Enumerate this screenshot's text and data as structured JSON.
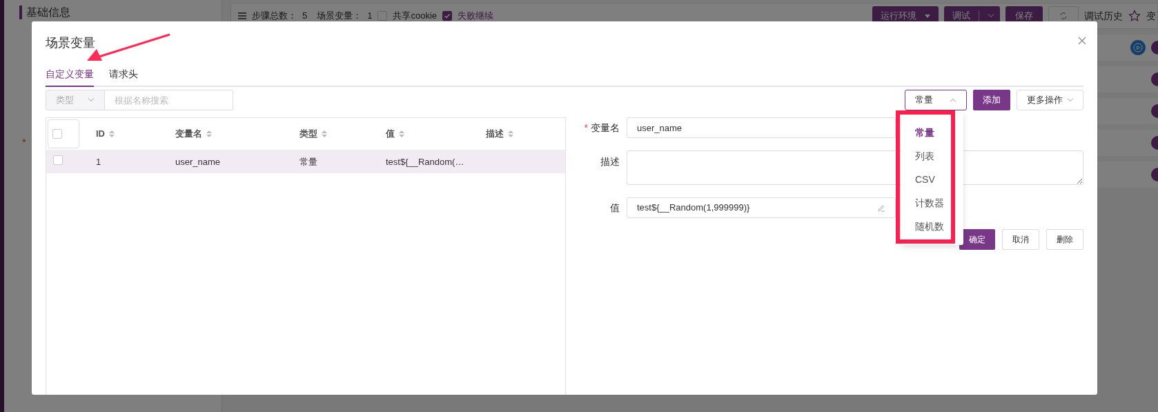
{
  "background": {
    "section_title": "基础信息",
    "required_mark": "*",
    "toolbar": {
      "step_total_label": "步骤总数：",
      "step_total": "5",
      "scene_vars_label": "场景变量：",
      "scene_vars": "1",
      "share_cookie": {
        "label": "共享cookie",
        "checked": false
      },
      "continue_on_fail": {
        "label": "失败继续",
        "checked": true
      },
      "buttons": [
        {
          "kind": "dropdown",
          "label": "运行环境"
        },
        {
          "kind": "split",
          "label": "调试"
        },
        {
          "kind": "plain",
          "label": "保存"
        },
        {
          "kind": "refresh"
        }
      ],
      "history": "调试历史",
      "changes_partial": "变"
    },
    "step_rows": [
      {
        "run_button": true,
        "enabled": true
      },
      {
        "run_button": false,
        "enabled": true
      },
      {
        "run_button": false,
        "enabled": true
      },
      {
        "run_button": false,
        "enabled": true
      },
      {
        "run_button": false,
        "enabled": true
      }
    ]
  },
  "dialog": {
    "title": "场景变量",
    "tabs": [
      {
        "label": "自定义变量",
        "selected": true
      },
      {
        "label": "请求头",
        "selected": false
      }
    ],
    "filter": {
      "type_placeholder": "类型",
      "search_placeholder": "根据名称搜索"
    },
    "type_select": {
      "value": "常量",
      "expanded": true,
      "options": [
        {
          "label": "常量",
          "selected": true
        },
        {
          "label": "列表",
          "selected": false
        },
        {
          "label": "CSV",
          "selected": false
        },
        {
          "label": "计数器",
          "selected": false
        },
        {
          "label": "随机数",
          "selected": false
        }
      ]
    },
    "add_button": "添加",
    "more_button": "更多操作",
    "table": {
      "select_all_checked": false,
      "columns": [
        "ID",
        "变量名",
        "类型",
        "值",
        "描述"
      ],
      "rows": [
        {
          "checked": false,
          "current": true,
          "cells": [
            "1",
            "user_name",
            "常量",
            "test${__Random(…"
          ]
        }
      ]
    },
    "form": {
      "name": {
        "label": "变量名",
        "required": true,
        "value": "user_name"
      },
      "description": {
        "label": "描述"
      },
      "value": {
        "label": "值",
        "value": "test${__Random(1,999999)}"
      },
      "buttons": [
        "确定",
        "取消",
        "删除"
      ]
    }
  }
}
